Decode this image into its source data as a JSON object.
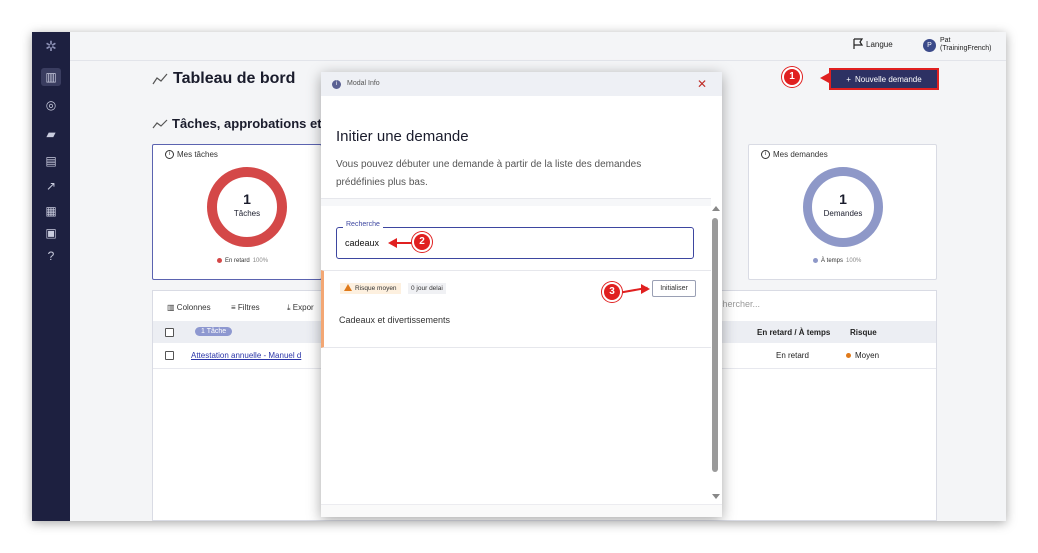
{
  "topbar": {
    "language_label": "Langue",
    "user_initial": "P",
    "user_name": "Pat",
    "user_tenant": "(TrainingFrench)"
  },
  "page": {
    "title": "Tableau de bord",
    "section_title": "Tâches, approbations et",
    "new_request_label": "Nouvelle demande"
  },
  "cards": {
    "tasks": {
      "title": "Mes tâches",
      "count": "1",
      "label": "Tâches",
      "legend": "En retard",
      "legend_pct": "100%",
      "color": "#d44848"
    },
    "requests": {
      "title": "Mes demandes",
      "count": "1",
      "label": "Demandes",
      "legend": "À temps",
      "legend_pct": "100%",
      "color": "#8e98c8"
    }
  },
  "table": {
    "toolbar": {
      "columns": "Colonnes",
      "filters": "Filtres",
      "export": "Expor",
      "search_placeholder": "chercher..."
    },
    "header": {
      "selected_pill": "1 Tâche",
      "late_on_time": "En retard / À temps",
      "risk": "Risque"
    },
    "rows": [
      {
        "link": "Attestation annuelle - Manuel d",
        "status": "En retard",
        "risk": "Moyen"
      }
    ]
  },
  "modal": {
    "header_title": "Modal Info",
    "title": "Initier une demande",
    "description": "Vous pouvez débuter une demande à partir de la liste des demandes prédéfinies plus bas.",
    "search_label": "Recherche",
    "search_value": "cadeaux",
    "result": {
      "risk_tag": "Risque moyen",
      "delay_tag": "0 jour delai",
      "init_button": "Initialiser",
      "name": "Cadeaux et divertissements"
    }
  },
  "markers": [
    "1",
    "2",
    "3"
  ],
  "colors": {
    "sidebar": "#1d2040",
    "primary": "#2d3163",
    "annotation": "#e02020"
  }
}
